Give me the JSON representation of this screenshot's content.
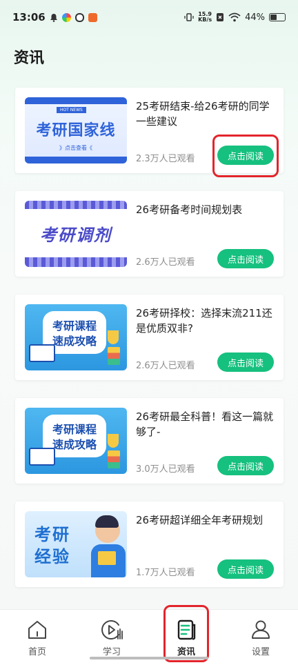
{
  "status_bar": {
    "time": "13:06",
    "net_speed_value": "15.9",
    "net_speed_unit": "KB/s",
    "battery": "44%"
  },
  "page": {
    "title": "资讯"
  },
  "articles": [
    {
      "title": "25考研结束-给26考研的同学一些建议",
      "views": "2.3万人已观看",
      "button": "点击阅读",
      "thumb": {
        "tag": "HOT NEWS",
        "headline": "考研国家线",
        "sub": "》点击查看《"
      }
    },
    {
      "title": "26考研备考时间规划表",
      "views": "2.6万人已观看",
      "button": "点击阅读",
      "thumb": {
        "headline": "考研调剂"
      }
    },
    {
      "title": "26考研择校：选择末流211还是优质双非?",
      "views": "2.6万人已观看",
      "button": "点击阅读",
      "thumb": {
        "line1": "考研课程",
        "line2": "速成攻略"
      }
    },
    {
      "title": "26考研最全科普！看这一篇就够了-",
      "views": "3.0万人已观看",
      "button": "点击阅读",
      "thumb": {
        "line1": "考研课程",
        "line2": "速成攻略"
      }
    },
    {
      "title": "26考研超详细全年考研规划",
      "views": "1.7万人已观看",
      "button": "点击阅读",
      "thumb": {
        "line1": "考研",
        "line2": "经验"
      }
    }
  ],
  "nav": [
    {
      "label": "首页",
      "icon": "home-icon"
    },
    {
      "label": "学习",
      "icon": "play-study-icon"
    },
    {
      "label": "资讯",
      "icon": "news-icon",
      "active": true
    },
    {
      "label": "设置",
      "icon": "user-settings-icon"
    }
  ],
  "colors": {
    "accent": "#16c07e",
    "highlight": "#e3242b"
  }
}
